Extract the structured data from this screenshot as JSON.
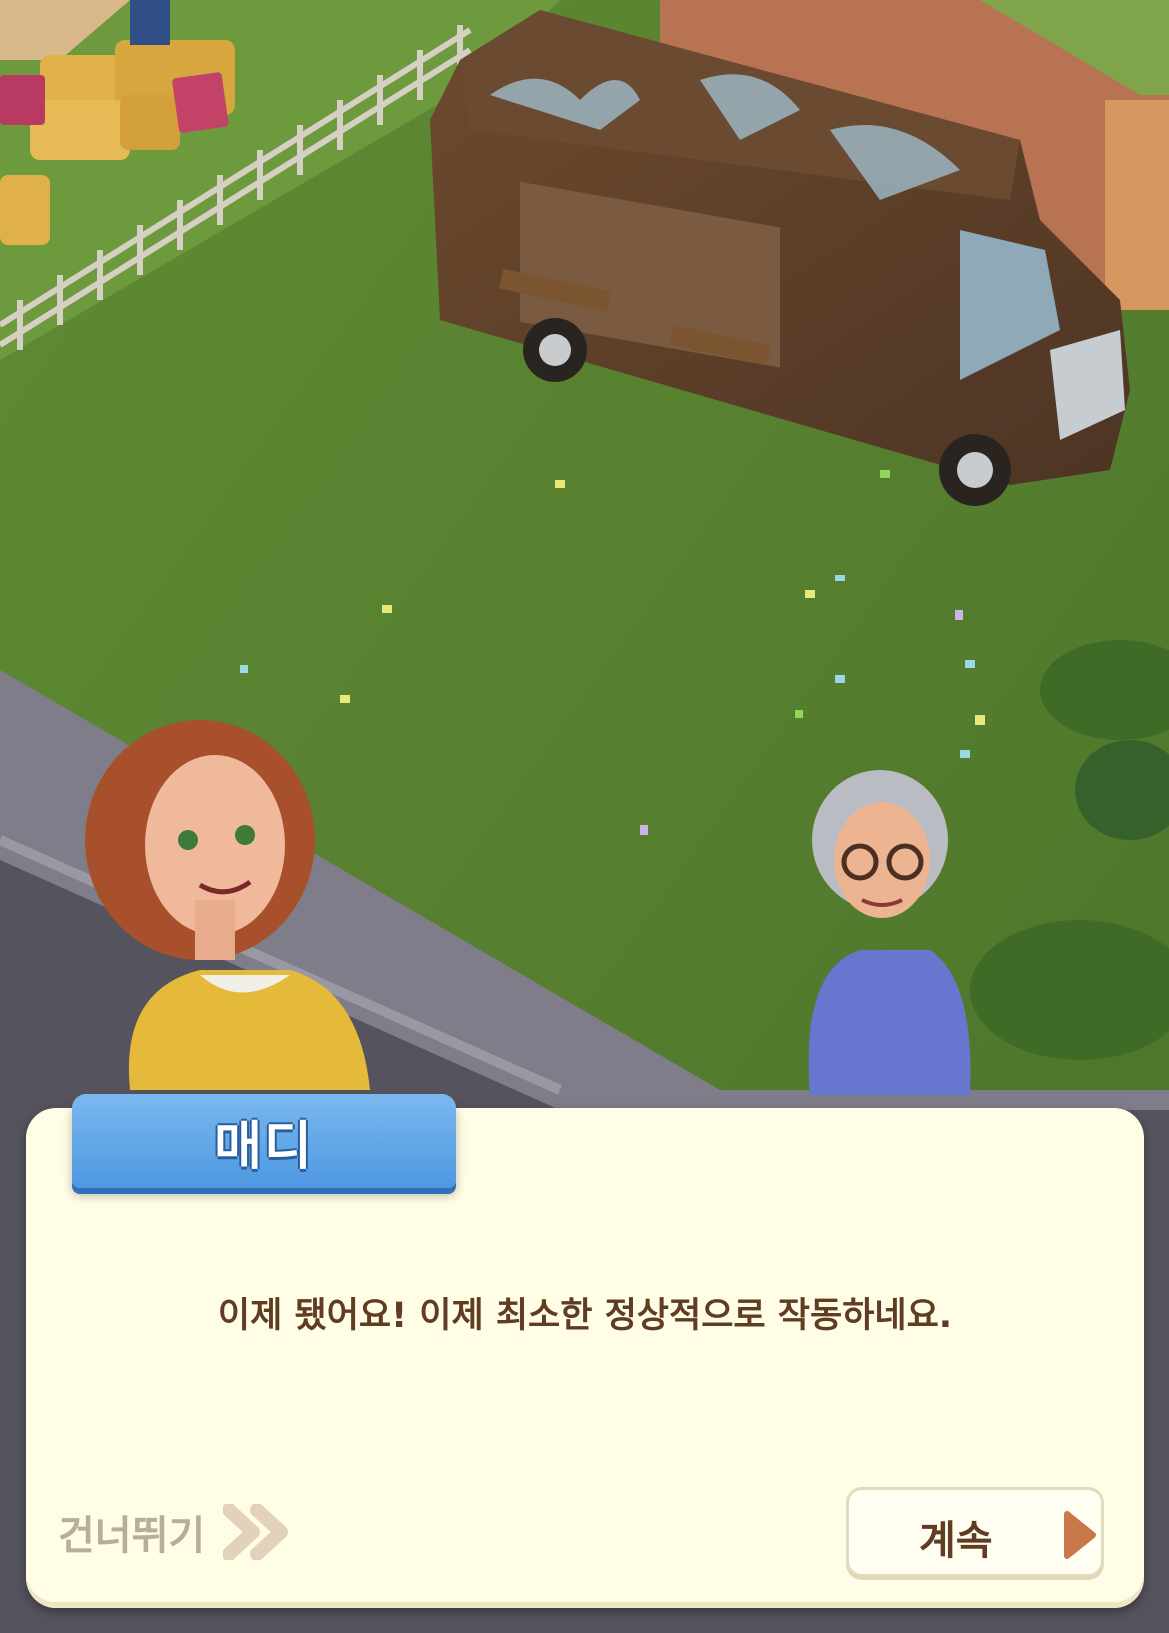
{
  "dialog": {
    "speaker_name": "매디",
    "message": "이제 됐어요! 이제 최소한 정상적으로 작동하네요.",
    "skip_label": "건너뛰기",
    "continue_label": "계속"
  },
  "icons": {
    "skip": "double-chevron-right-icon",
    "continue": "triangle-right-icon"
  },
  "colors": {
    "name_tab": "#5ba4e8",
    "dialog_bg": "#fffde6",
    "dialog_text": "#5f3c22",
    "skip_text": "#b7ad9a",
    "continue_arrow": "#c9784a"
  }
}
